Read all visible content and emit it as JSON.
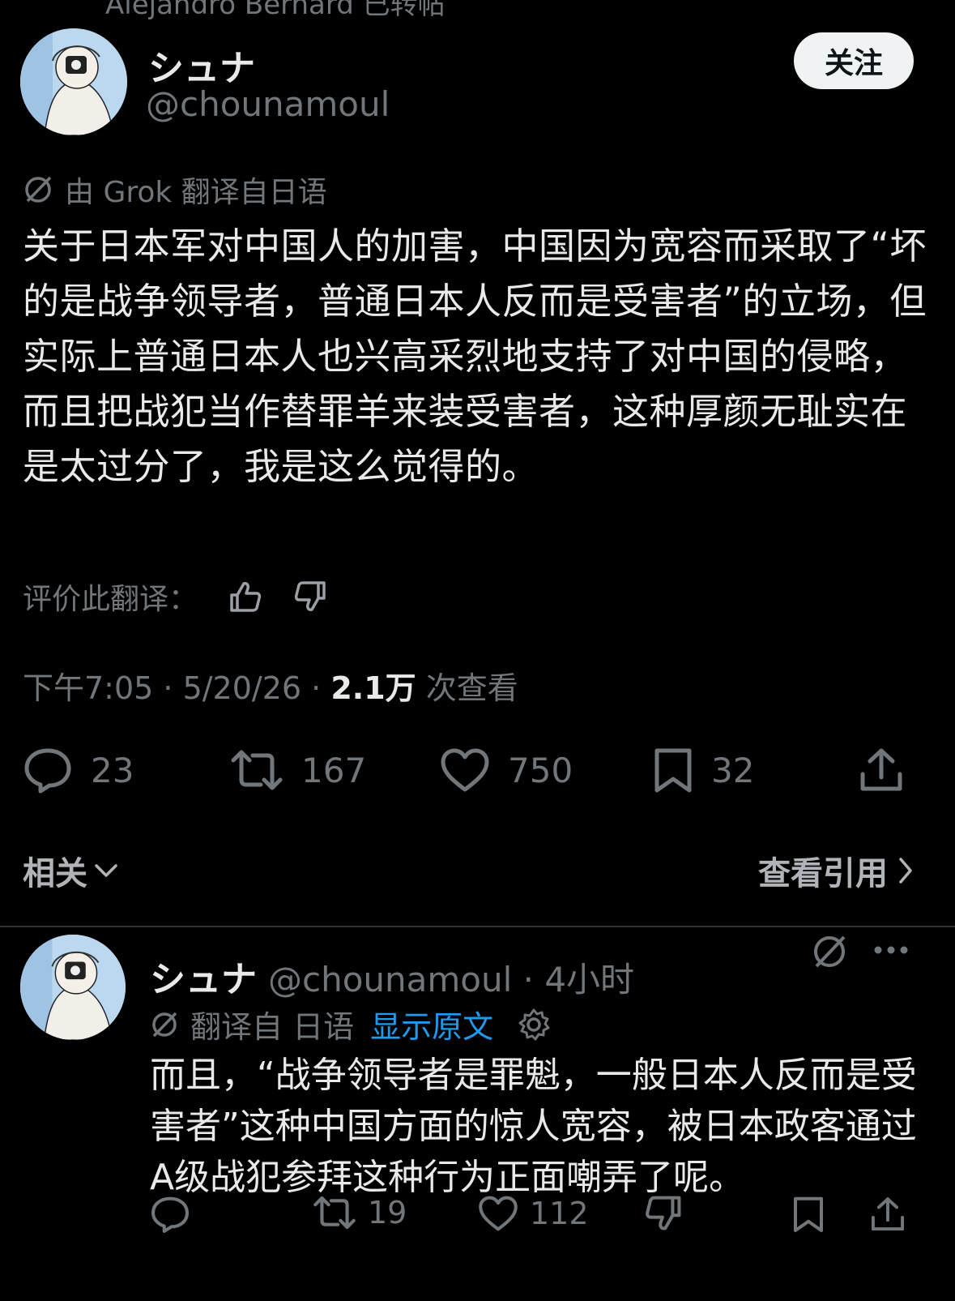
{
  "top_cut_text": "Alejandro Bernard 已转帖",
  "post": {
    "display_name": "シュナ",
    "handle": "@chounamoul",
    "follow_label": "关注",
    "translated_note": "由 Grok 翻译自日语",
    "text": "关于日本军对中国人的加害，中国因为宽容而采取了“坏的是战争领导者，普通日本人反而是受害者”的立场，但实际上普通日本人也兴高采烈地支持了对中国的侵略，而且把战犯当作替罪羊来装受害者，这种厚颜无耻实在是太过分了，我是这么觉得的。",
    "rate_label": "评价此翻译：",
    "time": "下午7:05 · 5/20/26 · ",
    "views_count": "2.1万",
    "views_label": " 次查看",
    "stats": {
      "replies": "23",
      "reposts": "167",
      "likes": "750",
      "bookmarks": "32"
    }
  },
  "related_label": "相关",
  "view_quotes_label": "查看引用",
  "reply": {
    "display_name": "シュナ",
    "handle_time": "@chounamoul · 4小时",
    "translated_from": "翻译自 日语",
    "show_original": "显示原文",
    "text": "而且，“战争领导者是罪魁，一般日本人反而是受害者”这种中国方面的惊人宽容，被日本政客通过A级战犯参拜这种行为正面嘲弄了呢。",
    "stats": {
      "reposts": "19",
      "likes": "112"
    }
  },
  "icons": [
    "repost-icon",
    "no-translate-icon",
    "thumbs-up-icon",
    "thumbs-down-icon",
    "reply-icon",
    "like-icon",
    "bookmark-icon",
    "share-icon",
    "chevron-down-icon",
    "chevron-right-icon",
    "gear-icon",
    "more-icon"
  ]
}
